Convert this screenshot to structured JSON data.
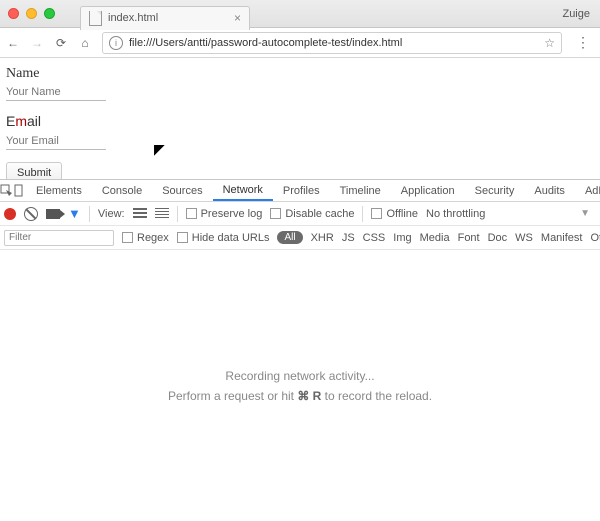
{
  "window": {
    "tab_title": "index.html",
    "profile": "Zuige"
  },
  "toolbar": {
    "url": "file:///Users/antti/password-autocomplete-test/index.html"
  },
  "page": {
    "name_label": "Name",
    "name_placeholder": "Your Name",
    "email_prefix": "E",
    "email_m": "m",
    "email_suffix": "ail",
    "email_placeholder": "Your Email",
    "submit_label": "Submit"
  },
  "devtools": {
    "tabs": {
      "elements": "Elements",
      "console": "Console",
      "sources": "Sources",
      "network": "Network",
      "profiles": "Profiles",
      "timeline": "Timeline",
      "application": "Application",
      "security": "Security",
      "audits": "Audits",
      "adblock": "AdBlock"
    },
    "row1": {
      "view": "View:",
      "preserve": "Preserve log",
      "disable_cache": "Disable cache",
      "offline": "Offline",
      "throttling": "No throttling"
    },
    "row2": {
      "filter_placeholder": "Filter",
      "regex": "Regex",
      "hide_urls": "Hide data URLs",
      "all": "All",
      "types": [
        "XHR",
        "JS",
        "CSS",
        "Img",
        "Media",
        "Font",
        "Doc",
        "WS",
        "Manifest",
        "Other"
      ]
    },
    "body": {
      "line1": "Recording network activity...",
      "line2a": "Perform a request or hit ",
      "shortcut": "⌘ R",
      "line2b": " to record the reload."
    }
  }
}
